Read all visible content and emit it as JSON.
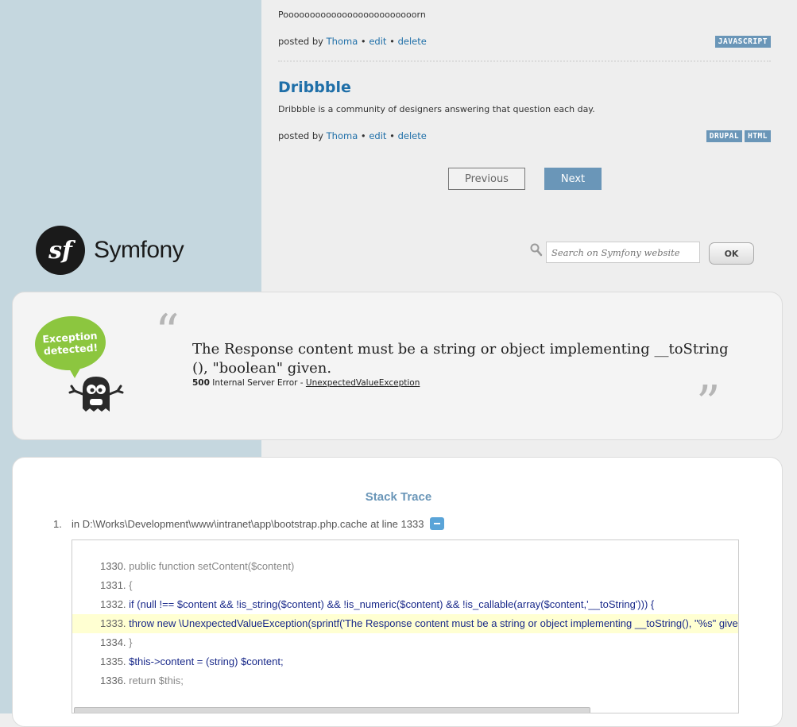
{
  "posts": [
    {
      "text": "Pooooooooooooooooooooooooorn",
      "posted_by_label": "posted by",
      "author": "Thoma",
      "edit": "edit",
      "delete": "delete",
      "tags": [
        "JAVASCRIPT"
      ]
    },
    {
      "title": "Dribbble",
      "text": "Dribbble is a community of designers answering that question each day.",
      "posted_by_label": "posted by",
      "author": "Thoma",
      "edit": "edit",
      "delete": "delete",
      "tags": [
        "DRUPAL",
        "HTML"
      ]
    }
  ],
  "pager": {
    "previous": "Previous",
    "next": "Next"
  },
  "header": {
    "logo_text": "Symfony",
    "logo_mark": "sf",
    "search_placeholder": "Search on Symfony website",
    "search_button": "OK"
  },
  "exception": {
    "badge_text": "Exception detected!",
    "message": "The Response content must be a string or object implementing __toString (), \"boolean\" given.",
    "status_code": "500",
    "status_text": "Internal Server Error -",
    "exception_class": "UnexpectedValueException",
    "quote_open": "“",
    "quote_close": "”"
  },
  "stack_trace": {
    "title": "Stack Trace",
    "items": [
      {
        "number": "1.",
        "location": "in D:\\Works\\Development\\www\\intranet\\app\\bootstrap.php.cache at line 1333",
        "code_lines": [
          {
            "num": "1330.",
            "code": "public function setContent($content)"
          },
          {
            "num": "1331.",
            "code": "{"
          },
          {
            "num": "1332.",
            "code": "if (null !== $content && !is_string($content) && !is_numeric($content) && !is_callable(array($content,'__toString'))) {"
          },
          {
            "num": "1333.",
            "code": "throw new \\UnexpectedValueException(sprintf('The Response content must be a string or object implementing __toString(), \"%s\" given.', gettype($content)));"
          },
          {
            "num": "1334.",
            "code": "}"
          },
          {
            "num": "1335.",
            "code": "$this->content = (string) $content;"
          },
          {
            "num": "1336.",
            "code": "return $this;"
          }
        ]
      }
    ]
  },
  "colors": {
    "sidebar_bg": "#c5d7df",
    "link": "#1f6fa8",
    "tag_bg": "#6a96b8",
    "badge_green": "#8cc63f",
    "highlight_line": "#ffffd2"
  }
}
